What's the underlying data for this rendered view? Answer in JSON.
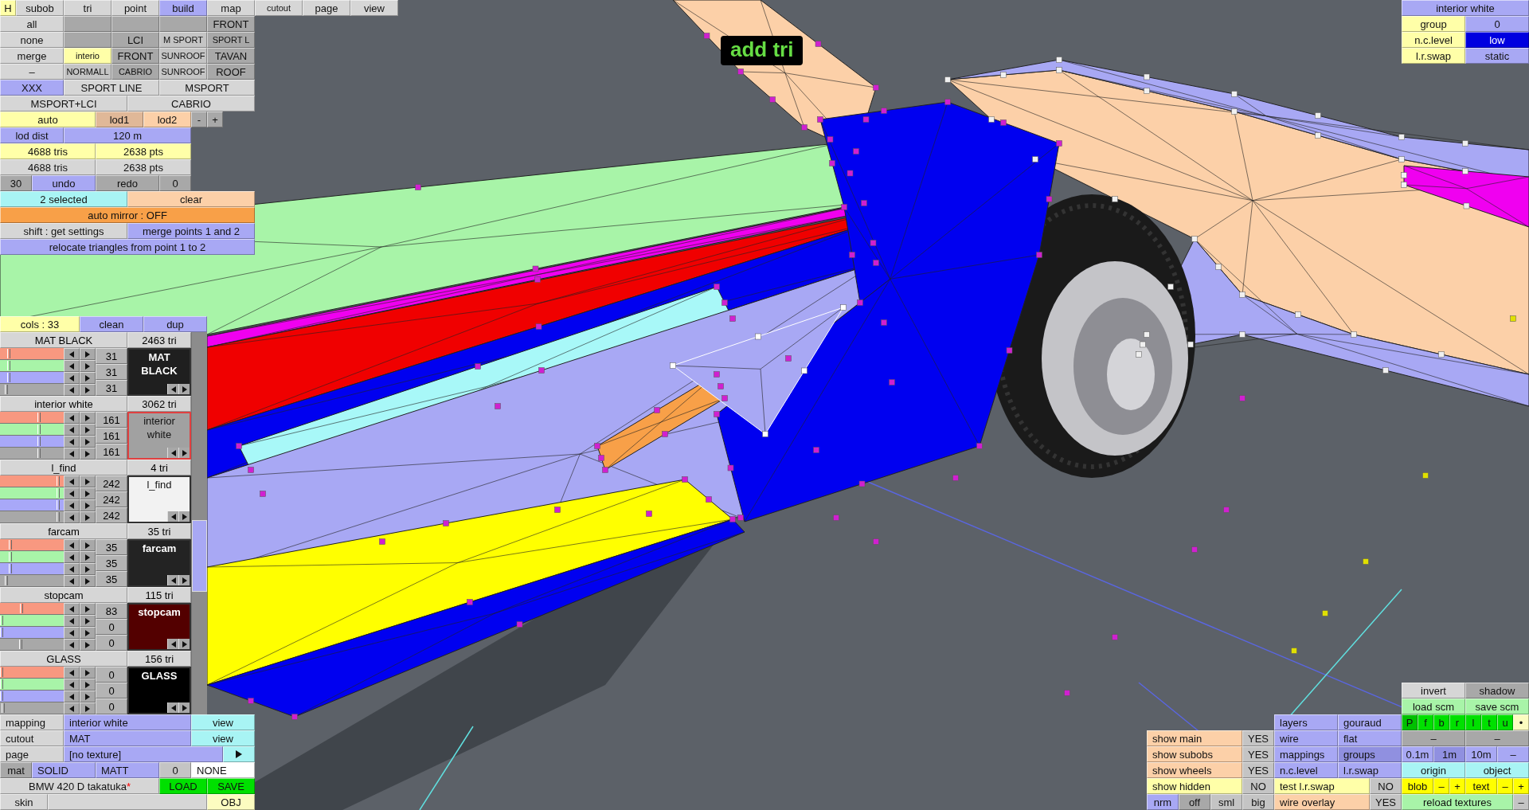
{
  "mode_tabs": [
    {
      "label": "H",
      "color": "#ffffa8"
    },
    {
      "label": "subob",
      "color": "#d6d6d6"
    },
    {
      "label": "tri",
      "color": "#d6d6d6"
    },
    {
      "label": "point",
      "color": "#d6d6d6"
    },
    {
      "label": "build",
      "color": "#a8a8f4"
    },
    {
      "label": "map",
      "color": "#d6d6d6"
    },
    {
      "label": "cutout",
      "color": "#d6d6d6"
    },
    {
      "label": "page",
      "color": "#d6d6d6"
    },
    {
      "label": "view",
      "color": "#d6d6d6"
    }
  ],
  "top_toolbar": {
    "buttons": [
      {
        "label": "all",
        "color": "#d6d6d6"
      },
      {
        "color": "#a8a8a8"
      },
      {
        "color": "#a8a8a8"
      },
      {
        "color": "#a8a8a8"
      },
      {
        "label": "FRONT",
        "color": "#a8a8a8"
      },
      {
        "label": "none",
        "color": "#d6d6d6"
      },
      {
        "color": "#a8a8a8"
      },
      {
        "label": "LCI",
        "color": "#a8a8a8"
      },
      {
        "label": "M SPORT",
        "color": "#c4c4c4"
      },
      {
        "label": "SPORT L",
        "color": "#a8a8a8"
      },
      {
        "label": "merge",
        "color": "#d6d6d6"
      },
      {
        "label": "interio",
        "color": "#ffffa8"
      },
      {
        "label": "FRONT",
        "color": "#a8a8a8"
      },
      {
        "label": "SUNROOF",
        "color": "#c4c4c4"
      },
      {
        "label": "TAVAN",
        "color": "#a8a8a8"
      },
      {
        "label": "–",
        "color": "#d6d6d6"
      },
      {
        "label": "NORMALL",
        "color": "#c4c4c4"
      },
      {
        "label": "CABRIO",
        "color": "#a8a8a8"
      },
      {
        "label": "SUNROOF",
        "color": "#c4c4c4"
      },
      {
        "label": "ROOF",
        "color": "#a8a8a8"
      },
      {
        "label": "XXX",
        "color": "#a8a8f4"
      },
      {
        "label": "SPORT LINE",
        "color": "#d6d6d6"
      },
      {
        "label": "MSPORT",
        "color": "#d6d6d6"
      },
      {
        "label": "MSPORT+LCI",
        "color": "#d6d6d6"
      },
      {
        "label": "CABRIO",
        "color": "#d6d6d6"
      },
      {
        "label": "auto",
        "color": "#ffffa8"
      },
      {
        "label": "lod1",
        "color": "#e0b898"
      },
      {
        "label": "lod2",
        "color": "#fcd0a8"
      },
      {
        "label": "-",
        "color": "#a8a8a8"
      },
      {
        "label": "+",
        "color": "#a8a8a8"
      },
      {
        "label": "lod dist",
        "color": "#a8a8f4"
      },
      {
        "label": "120 m",
        "color": "#a8a8f4"
      },
      {
        "label": "4688 tris",
        "color": "#ffffa8"
      },
      {
        "label": "2638 pts",
        "color": "#ffffa8"
      },
      {
        "label": "4688 tris",
        "color": "#d6d6d6"
      },
      {
        "label": "2638 pts",
        "color": "#d6d6d6"
      },
      {
        "label": "30",
        "color": "#a8a8a8"
      },
      {
        "label": "undo",
        "color": "#a8a8f4"
      },
      {
        "label": "redo",
        "color": "#a8a8a8"
      },
      {
        "label": "0",
        "color": "#a8a8a8"
      },
      {
        "label": "2 selected",
        "color": "#a8f4f4"
      },
      {
        "label": "clear",
        "color": "#fcd0a8"
      },
      {
        "label": "auto mirror : OFF",
        "color": "#f8a048"
      },
      {
        "label": "shift : get settings",
        "color": "#d6d6d6"
      },
      {
        "label": "merge points 1 and 2",
        "color": "#a8a8f4"
      },
      {
        "label": "relocate triangles from point 1 to 2",
        "color": "#a8a8f4"
      }
    ]
  },
  "viewport": {
    "mode_label": "add tri"
  },
  "group_info": {
    "buttons": [
      {
        "label": "interior white",
        "color": "#a8a8f4"
      },
      {
        "label": "group",
        "color": "#ffffa8"
      },
      {
        "label": "0",
        "color": "#a8a8f4"
      },
      {
        "label": "n.c.level",
        "color": "#ffffa8"
      },
      {
        "label": "low",
        "color": "#0000e0"
      },
      {
        "label": "l.r.swap",
        "color": "#ffffa8"
      },
      {
        "label": "static",
        "color": "#a8a8f4"
      }
    ]
  },
  "materials_panel": {
    "header": [
      {
        "label": "cols : 33",
        "color": "#ffffa8"
      },
      {
        "label": "clean",
        "color": "#a8a8f4"
      },
      {
        "label": "dup",
        "color": "#a8a8f4"
      }
    ],
    "materials": [
      {
        "name": "MAT BLACK",
        "tris": "2463 tri",
        "swatch_label": "MAT BLACK",
        "color": "#1f1f1f",
        "selected": false,
        "channels": [
          {
            "value": "31",
            "level": 0.12
          },
          {
            "value": "31",
            "level": 0.12
          },
          {
            "value": "31",
            "level": 0.12
          },
          {
            "level": 0.08
          }
        ]
      },
      {
        "name": "interior white",
        "tris": "3062 tri",
        "swatch_label": "interior white",
        "color": "#a1a1a1",
        "selected": true,
        "channels": [
          {
            "value": "161",
            "level": 0.63
          },
          {
            "value": "161",
            "level": 0.63
          },
          {
            "value": "161",
            "level": 0.63
          },
          {
            "level": 0.62
          }
        ]
      },
      {
        "name": "l_find",
        "tris": "4 tri",
        "swatch_label": "l_find",
        "color": "#f2f2f2",
        "selected": false,
        "channels": [
          {
            "value": "242",
            "level": 0.95
          },
          {
            "value": "242",
            "level": 0.95
          },
          {
            "value": "242",
            "level": 0.95
          },
          {
            "level": 0.95
          }
        ]
      },
      {
        "name": "farcam",
        "tris": "35 tri",
        "swatch_label": "farcam",
        "color": "#232323",
        "selected": false,
        "channels": [
          {
            "value": "35",
            "level": 0.14
          },
          {
            "value": "35",
            "level": 0.14
          },
          {
            "value": "35",
            "level": 0.14
          },
          {
            "level": 0.08
          }
        ]
      },
      {
        "name": "stopcam",
        "tris": "115 tri",
        "swatch_label": "stopcam",
        "color": "#530000",
        "selected": false,
        "channels": [
          {
            "value": "83",
            "level": 0.33
          },
          {
            "value": "0",
            "level": 0
          },
          {
            "value": "0",
            "level": 0
          },
          {
            "level": 0.32
          }
        ]
      },
      {
        "name": "GLASS",
        "tris": "156 tri",
        "swatch_label": "GLASS",
        "color": "#000000",
        "selected": false,
        "channels": [
          {
            "value": "0",
            "level": 0
          },
          {
            "value": "0",
            "level": 0
          },
          {
            "value": "0",
            "level": 0
          },
          {
            "level": 0.03
          }
        ]
      }
    ]
  },
  "material_settings": {
    "buttons": [
      {
        "label": "mapping",
        "color": "#d6d6d6"
      },
      {
        "label": "interior white",
        "color": "#a8a8f4"
      },
      {
        "label": "view",
        "color": "#a8f4f4"
      },
      {
        "label": "cutout",
        "color": "#d6d6d6"
      },
      {
        "label": "MAT",
        "color": "#a8a8f4"
      },
      {
        "label": "view",
        "color": "#a8f4f4"
      },
      {
        "label": "page",
        "color": "#d6d6d6"
      },
      {
        "label": "[no texture]",
        "color": "#a8a8f4"
      },
      {
        "color": "#a8f4f4"
      },
      {
        "label": "mat",
        "color": "#a8a8a8"
      },
      {
        "label": "SOLID",
        "color": "#a8a8f4"
      },
      {
        "label": "MATT",
        "color": "#a8a8f4"
      },
      {
        "label": "0",
        "color": "#c4c4c4"
      },
      {
        "label": "NONE",
        "color": "#ffffff"
      },
      {
        "label": "BMW 420 D takatuka",
        "suffix": "*",
        "color": "#d6d6d6"
      },
      {
        "label": "LOAD",
        "color": "#00e000"
      },
      {
        "label": "SAVE",
        "color": "#00e000"
      },
      {
        "label": "skin",
        "color": "#d6d6d6"
      },
      {
        "color": "#d6d6d6"
      },
      {
        "label": "OBJ",
        "color": "#fcfcc0"
      }
    ]
  },
  "visibility_options": {
    "buttons": [
      {
        "label": "show main",
        "color": "#fcd0a8"
      },
      {
        "label": "YES",
        "color": "#c4c4c4"
      },
      {
        "label": "show subobs",
        "color": "#fcd0a8"
      },
      {
        "label": "YES",
        "color": "#c4c4c4"
      },
      {
        "label": "show wheels",
        "color": "#fcd0a8"
      },
      {
        "label": "YES",
        "color": "#c4c4c4"
      },
      {
        "label": "show hidden",
        "color": "#ffffa8"
      },
      {
        "label": "NO",
        "color": "#c4c4c4"
      },
      {
        "label": "nrm",
        "color": "#a8a8f4"
      },
      {
        "label": "off",
        "color": "#a8a8a8"
      },
      {
        "label": "sml",
        "color": "#c4c4c4"
      },
      {
        "label": "big",
        "color": "#c4c4c4"
      }
    ]
  },
  "render_options": {
    "buttons": [
      {
        "label": "layers",
        "color": "#a8a8f4"
      },
      {
        "label": "gouraud",
        "color": "#a8a8f4"
      },
      {
        "label": "wire",
        "color": "#a8a8f4"
      },
      {
        "label": "flat",
        "color": "#a8a8f4"
      },
      {
        "label": "mappings",
        "color": "#a8a8f4"
      },
      {
        "label": "groups",
        "color": "#9090e0"
      },
      {
        "label": "n.c.level",
        "color": "#a8a8f4"
      },
      {
        "label": "l.r.swap",
        "color": "#a8a8f4"
      },
      {
        "label": "test l.r.swap",
        "color": "#ffffa8"
      },
      {
        "label": "NO",
        "color": "#c4c4c4"
      },
      {
        "label": "wire overlay",
        "color": "#fcd0a8"
      },
      {
        "label": "YES",
        "color": "#c4c4c4"
      }
    ]
  },
  "tool_options": {
    "buttons": [
      {
        "label": "invert",
        "color": "#d6d6d6"
      },
      {
        "label": "shadow",
        "color": "#a8a8a8"
      },
      {
        "label": "load scm",
        "color": "#a8f4a8"
      },
      {
        "label": "save scm",
        "color": "#a8f4a8"
      },
      {
        "label": "P",
        "color": "#00c000"
      },
      {
        "label": "f",
        "color": "#00e000"
      },
      {
        "label": "b",
        "color": "#00e000"
      },
      {
        "label": "r",
        "color": "#00e000"
      },
      {
        "label": "l",
        "color": "#00e000"
      },
      {
        "label": "t",
        "color": "#00e000"
      },
      {
        "label": "u",
        "color": "#00e000"
      },
      {
        "label": "•",
        "color": "#fcfcc0"
      },
      {
        "label": "–",
        "color": "#a8a8a8"
      },
      {
        "label": "–",
        "color": "#a8a8a8"
      },
      {
        "label": "0.1m",
        "color": "#a8a8f4"
      },
      {
        "label": "1m",
        "color": "#9090e0"
      },
      {
        "label": "10m",
        "color": "#a8a8f4"
      },
      {
        "label": "–",
        "color": "#a8a8f4"
      },
      {
        "label": "origin",
        "color": "#a8f4f4"
      },
      {
        "label": "object",
        "color": "#a8f4f4"
      },
      {
        "label": "blob",
        "color": "#ffff00"
      },
      {
        "label": "–",
        "color": "#ffff00"
      },
      {
        "label": "+",
        "color": "#ffff00"
      },
      {
        "label": "text",
        "color": "#ffff00"
      },
      {
        "label": "–",
        "color": "#ffff00"
      },
      {
        "label": "+",
        "color": "#ffff00"
      },
      {
        "label": "reload textures",
        "color": "#a8f4a8"
      },
      {
        "label": "–",
        "color": "#c4c4c4"
      }
    ]
  }
}
